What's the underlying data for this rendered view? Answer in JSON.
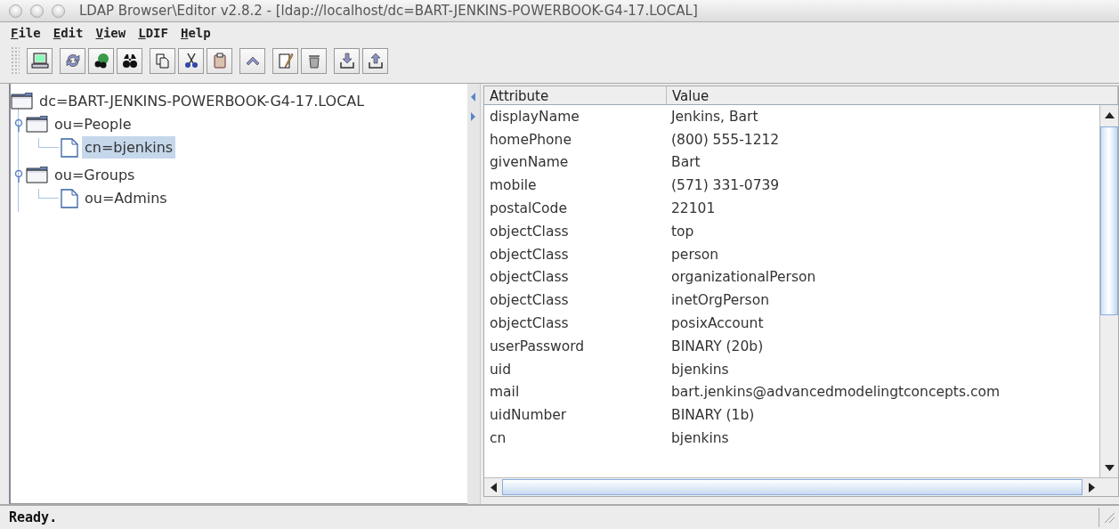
{
  "window": {
    "title": "LDAP Browser\\Editor v2.8.2 - [ldap://localhost/dc=BART-JENKINS-POWERBOOK-G4-17.LOCAL]"
  },
  "menu": [
    "File",
    "Edit",
    "View",
    "LDIF",
    "Help"
  ],
  "tree": [
    {
      "label": "dc=BART-JENKINS-POWERBOOK-G4-17.LOCAL",
      "kind": "folder",
      "selected": false,
      "children": [
        {
          "label": "ou=People",
          "kind": "folder",
          "selected": false,
          "expanded": true,
          "children": [
            {
              "label": "cn=bjenkins",
              "kind": "entry",
              "selected": true
            }
          ]
        },
        {
          "label": "ou=Groups",
          "kind": "folder",
          "selected": false,
          "expanded": true,
          "children": [
            {
              "label": "ou=Admins",
              "kind": "entry",
              "selected": false
            }
          ]
        }
      ]
    }
  ],
  "table": {
    "columns": [
      "Attribute",
      "Value"
    ],
    "rows": [
      [
        "displayName",
        "Jenkins, Bart"
      ],
      [
        "homePhone",
        "(800) 555-1212"
      ],
      [
        "givenName",
        "Bart"
      ],
      [
        "mobile",
        "(571) 331-0739"
      ],
      [
        "postalCode",
        "22101"
      ],
      [
        "objectClass",
        "top"
      ],
      [
        "objectClass",
        "person"
      ],
      [
        "objectClass",
        "organizationalPerson"
      ],
      [
        "objectClass",
        "inetOrgPerson"
      ],
      [
        "objectClass",
        "posixAccount"
      ],
      [
        "userPassword",
        "BINARY (20b)"
      ],
      [
        "uid",
        "bjenkins"
      ],
      [
        "mail",
        "bart.jenkins@advancedmodelingtconcepts.com"
      ],
      [
        "uidNumber",
        "BINARY (1b)"
      ],
      [
        "cn",
        "bjenkins"
      ]
    ]
  },
  "status_bar": "Ready."
}
